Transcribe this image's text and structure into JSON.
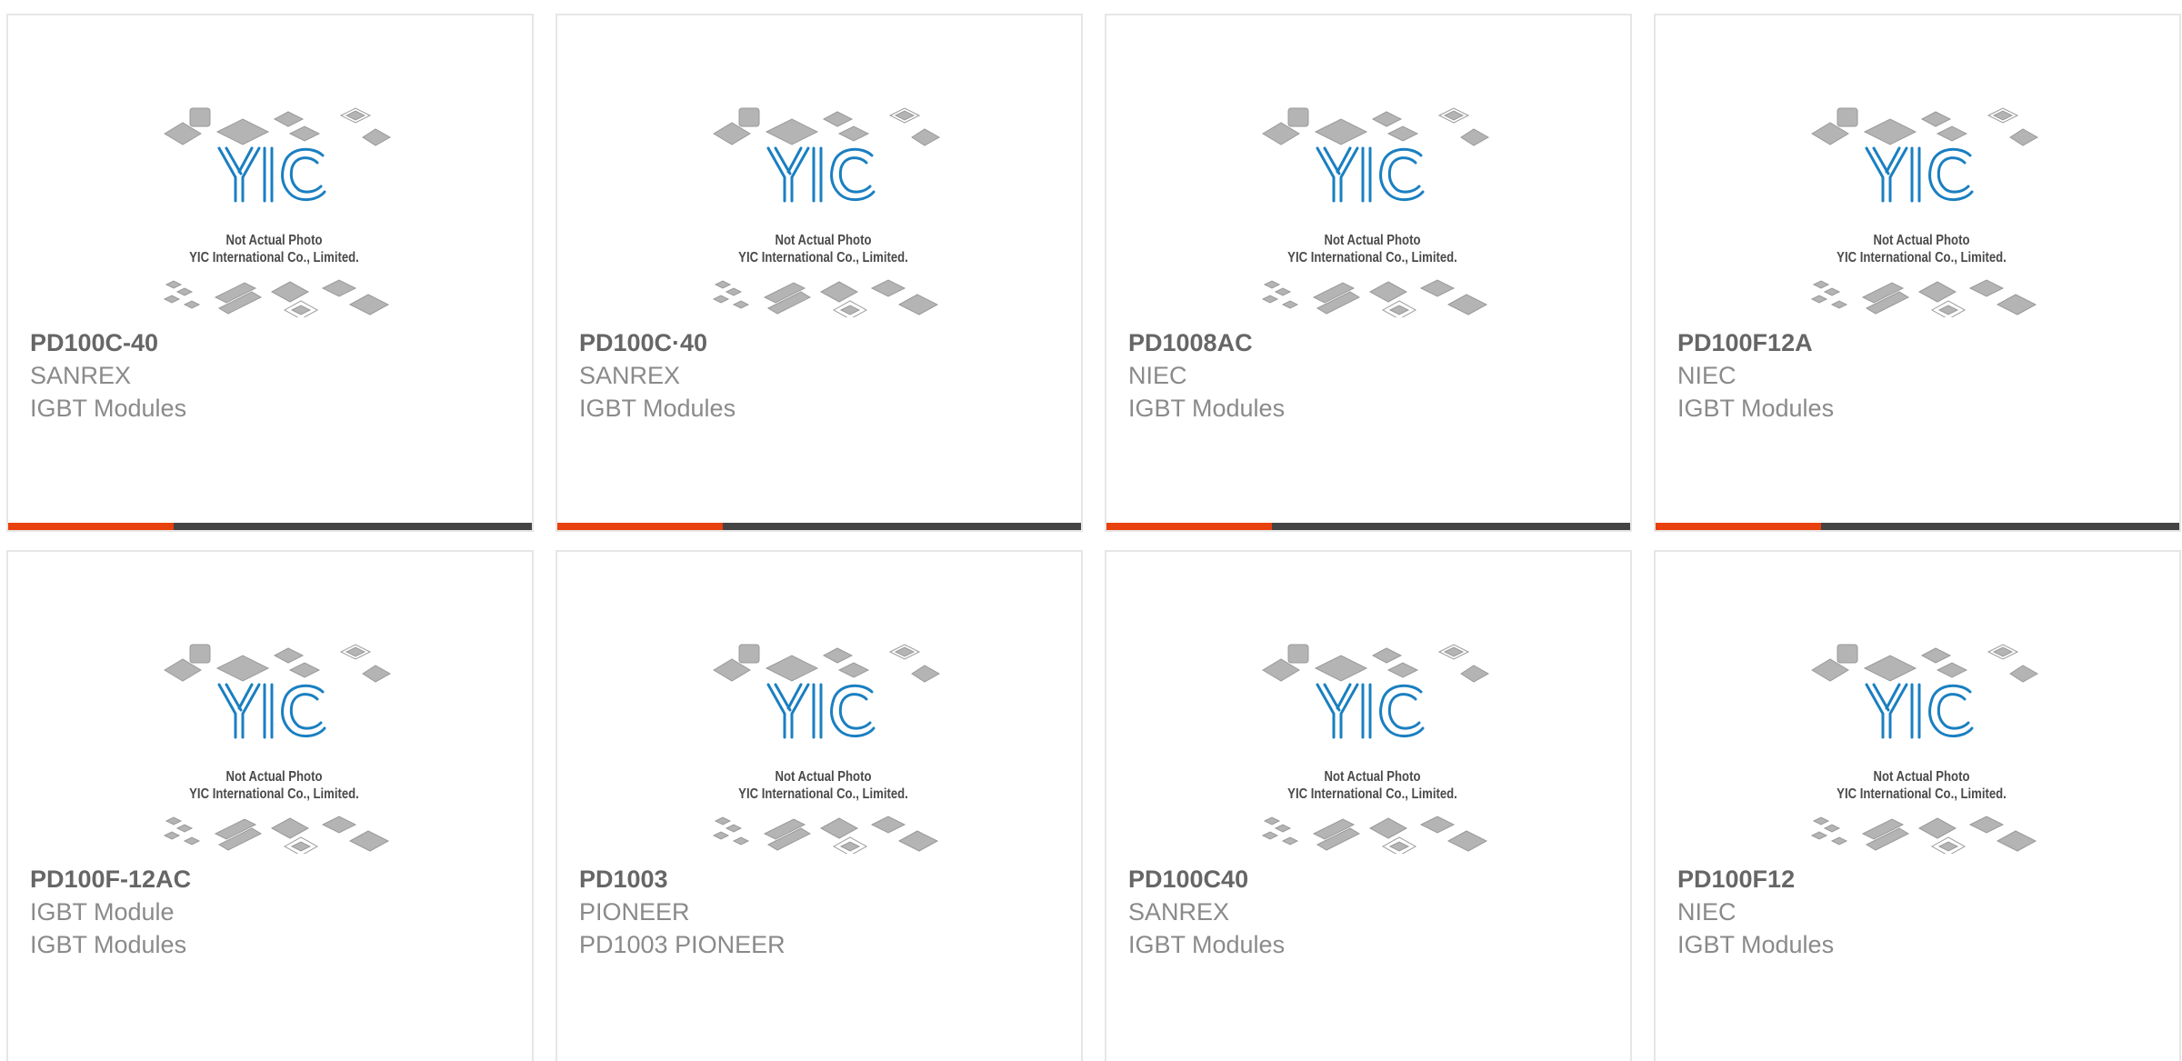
{
  "placeholder": {
    "line1": "Not Actual Photo",
    "line2": "YIC International Co., Limited.",
    "logo_text": "YIC",
    "logo_color": "#1a7fc1",
    "chip_color": "#b4b4b4"
  },
  "colors": {
    "accent": "#e8410e",
    "bar": "#444444",
    "part_text": "#666666",
    "meta_text": "#8a8a8a",
    "border": "#e6e6e6"
  },
  "products": [
    {
      "part": "PD100C-40",
      "line1": "SANREX",
      "line2": "IGBT Modules"
    },
    {
      "part": "PD100C·40",
      "line1": "SANREX",
      "line2": "IGBT Modules"
    },
    {
      "part": "PD1008AC",
      "line1": "NIEC",
      "line2": "IGBT Modules"
    },
    {
      "part": "PD100F12A",
      "line1": "NIEC",
      "line2": "IGBT Modules"
    },
    {
      "part": "PD100F-12AC",
      "line1": "IGBT Module",
      "line2": "IGBT Modules"
    },
    {
      "part": "PD1003",
      "line1": "PIONEER",
      "line2": "PD1003 PIONEER"
    },
    {
      "part": "PD100C40",
      "line1": "SANREX",
      "line2": "IGBT Modules"
    },
    {
      "part": "PD100F12",
      "line1": "NIEC",
      "line2": "IGBT Modules"
    }
  ]
}
